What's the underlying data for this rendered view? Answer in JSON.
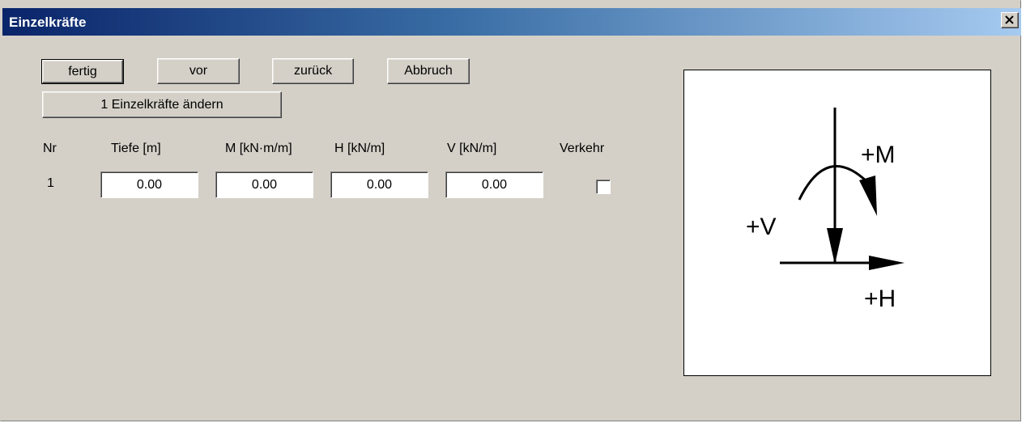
{
  "window": {
    "title": "Einzelkräfte",
    "close_icon": "close-x-icon"
  },
  "toolbar": {
    "fertig": "fertig",
    "vor": "vor",
    "zurueck": "zurück",
    "abbruch": "Abbruch",
    "aendern": "1 Einzelkräfte ändern"
  },
  "table": {
    "headers": {
      "nr": "Nr",
      "tiefe": "Tiefe [m]",
      "m": "M [kN·m/m]",
      "h": "H [kN/m]",
      "v": "V [kN/m]",
      "verkehr": "Verkehr"
    },
    "rows": [
      {
        "nr": "1",
        "tiefe": "0.00",
        "m": "0.00",
        "h": "0.00",
        "v": "0.00",
        "verkehr": false
      }
    ]
  },
  "diagram": {
    "label_m": "+M",
    "label_v": "+V",
    "label_h": "+H"
  }
}
